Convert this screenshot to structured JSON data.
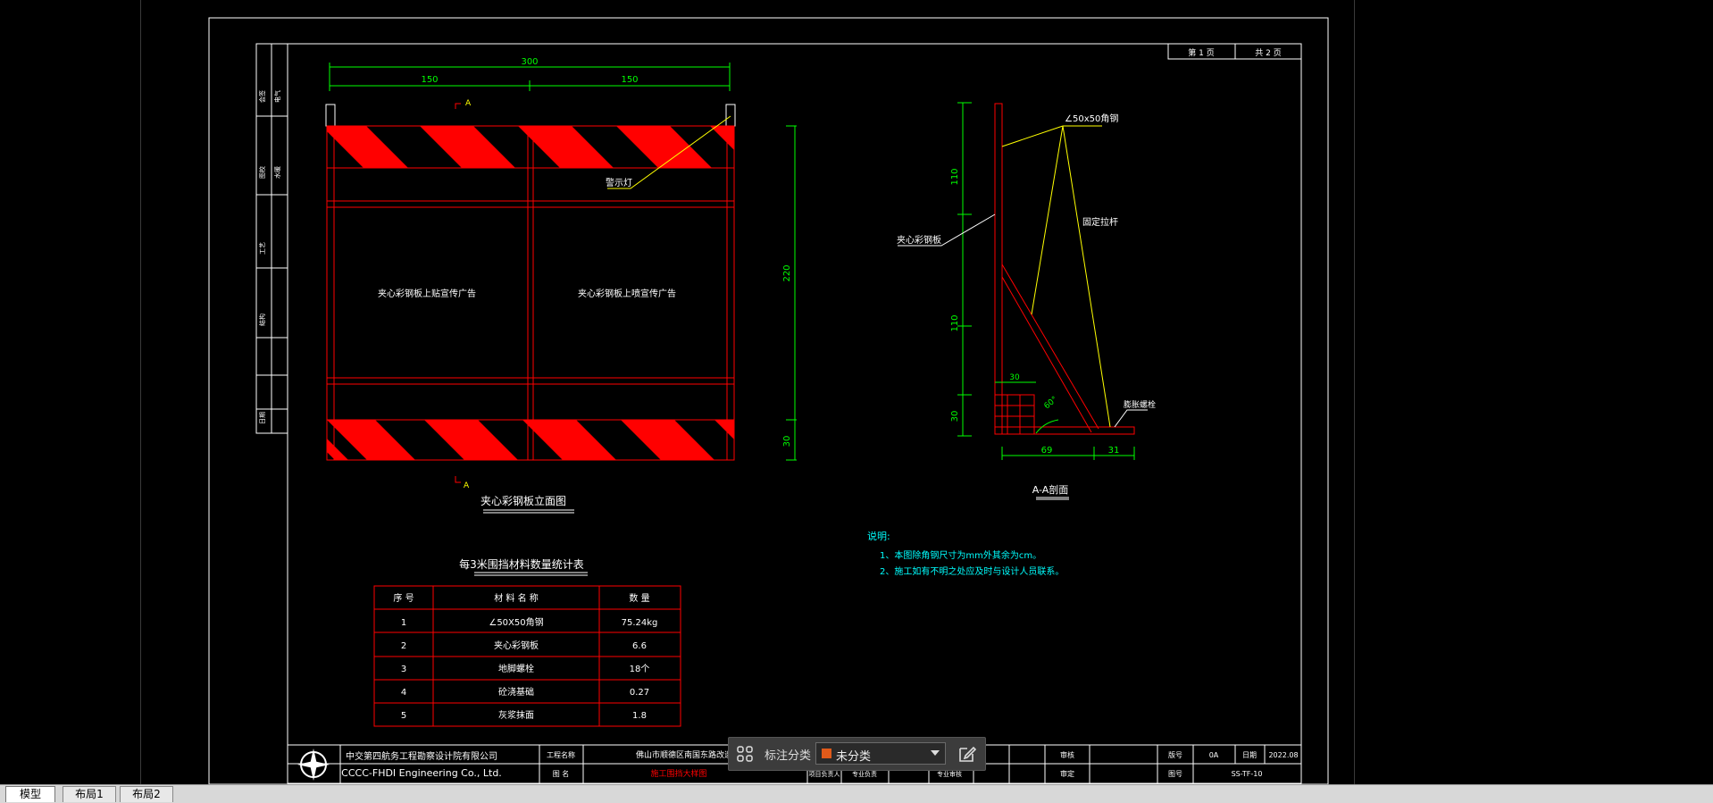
{
  "colors": {
    "red": "#ff0000",
    "green": "#00ff00",
    "yellow": "#ffff00",
    "white": "#ffffff",
    "cyan": "#00ffff"
  },
  "title_block": {
    "sheet_no_label": "第 1 页",
    "total_label": "共 2 页",
    "company_cn": "中交第四航务工程勘察设计院有限公司",
    "company_en": "CCCC-FHDI Engineering Co., Ltd.",
    "project_label": "工程名称",
    "project_name": "佛山市顺德区南国东路改造工程(二期)",
    "drawing_label": "图 名",
    "drawing_name": "施工围挡大样图",
    "designer_label": "项目负责人",
    "checker_label": "专业负责",
    "specialty_label": "专业审核",
    "audit_label": "审核",
    "approve_label": "审定",
    "version_label": "版号",
    "version_value": "0A",
    "date_label": "日期",
    "date_value": "2022.08",
    "drawing_no_label": "图号",
    "drawing_no_value": "SS-TF-10"
  },
  "elevation": {
    "dim_total": "300",
    "dim_left": "150",
    "dim_right": "150",
    "dim_height": "220",
    "dim_bottom": "30",
    "section_mark_top": "A",
    "section_mark_bottom": "A",
    "warning_light_label": "警示灯",
    "panel_left_text": "夹心彩钢板上贴宣传广告",
    "panel_right_text": "夹心彩钢板上喷宣传广告",
    "title": "夹心彩钢板立面图"
  },
  "section": {
    "angle_label": "∠50x50角钢",
    "steel_panel_label": "夹心彩钢板",
    "brace_label": "固定拉杆",
    "bolt_label": "膨胀螺栓",
    "dim_110_top": "110",
    "dim_110_mid": "110",
    "dim_30_left": "30",
    "dim_30_top": "30",
    "dim_69": "69",
    "dim_31": "31",
    "angle_deg": "60°",
    "title": "A-A剖面"
  },
  "notes": {
    "heading": "说明:",
    "items": [
      "1、本图除角钢尺寸为mm外其余为cm。",
      "2、施工如有不明之处应及时与设计人员联系。"
    ]
  },
  "table": {
    "title": "每3米围挡材料数量统计表",
    "headers": [
      "序 号",
      "材 料 名 称",
      "数 量"
    ],
    "rows": [
      [
        "1",
        "∠50X50角钢",
        "75.24kg"
      ],
      [
        "2",
        "夹心彩钢板",
        "6.6"
      ],
      [
        "3",
        "地脚螺栓",
        "18个"
      ],
      [
        "4",
        "砼浇基础",
        "0.27"
      ],
      [
        "5",
        "灰浆抹面",
        "1.8"
      ]
    ]
  },
  "left_strip": {
    "cells": [
      "会签",
      "图校",
      "工艺",
      "结构",
      "电气",
      "水暖",
      "日期"
    ]
  },
  "annotation_toolbar": {
    "label": "标注分类",
    "selected": "未分类",
    "swatch_color": "#e05a1a"
  },
  "tabs": [
    {
      "label": "模型",
      "active": true
    },
    {
      "label": "布局1",
      "active": false
    },
    {
      "label": "布局2",
      "active": false
    }
  ]
}
